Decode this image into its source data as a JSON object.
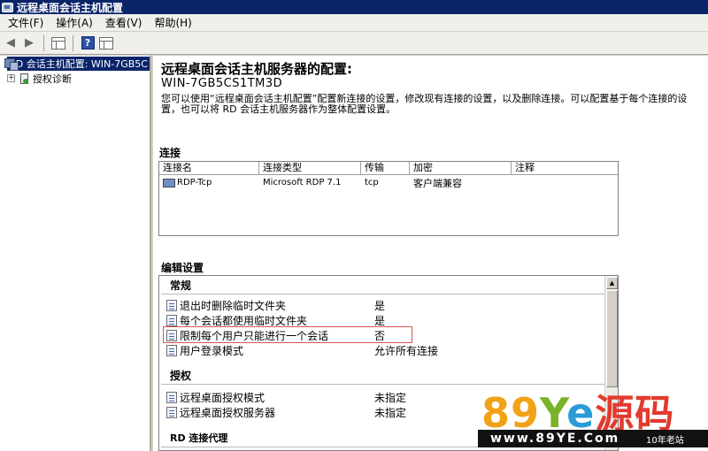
{
  "window": {
    "title": "远程桌面会话主机配置"
  },
  "menu": [
    "文件(F)",
    "操作(A)",
    "查看(V)",
    "帮助(H)"
  ],
  "toolbar": {
    "help_glyph": "?"
  },
  "tree": {
    "root_label": "RD 会话主机配置: WIN-7GB5C",
    "child_label": "授权诊断",
    "child_expander": "+"
  },
  "main": {
    "title": "远程桌面会话主机服务器的配置:",
    "server_name": "WIN-7GB5CS1TM3D",
    "description": "您可以使用“远程桌面会话主机配置”配置新连接的设置，修改现有连接的设置，以及删除连接。可以配置基于每个连接的设置，也可以将 RD 会话主机服务器作为整体配置设置。"
  },
  "connections": {
    "heading": "连接",
    "columns": [
      "连接名",
      "连接类型",
      "传输",
      "加密",
      "注释"
    ],
    "rows": [
      {
        "name": "RDP-Tcp",
        "type": "Microsoft RDP 7.1",
        "transport": "tcp",
        "encryption": "客户端兼容",
        "comment": ""
      }
    ]
  },
  "edit": {
    "heading": "编辑设置",
    "groups": [
      {
        "title": "常规",
        "items": [
          {
            "name": "退出时删除临时文件夹",
            "value": "是"
          },
          {
            "name": "每个会话都使用临时文件夹",
            "value": "是"
          },
          {
            "name": "限制每个用户只能进行一个会话",
            "value": "否"
          },
          {
            "name": "用户登录模式",
            "value": "允许所有连接"
          }
        ]
      },
      {
        "title": "授权",
        "items": [
          {
            "name": "远程桌面授权模式",
            "value": "未指定"
          },
          {
            "name": "远程桌面授权服务器",
            "value": "未指定"
          }
        ]
      },
      {
        "title": "RD 连接代理",
        "items": []
      }
    ]
  },
  "watermark": {
    "big_a": "89",
    "big_y": "Y",
    "big_e": "e",
    "big_zh": "源码",
    "url": "www.89YE.Com",
    "tag": "10年老站"
  },
  "colors": {
    "title_bar": "#0a246a",
    "highlight_box": "#d9534f"
  }
}
